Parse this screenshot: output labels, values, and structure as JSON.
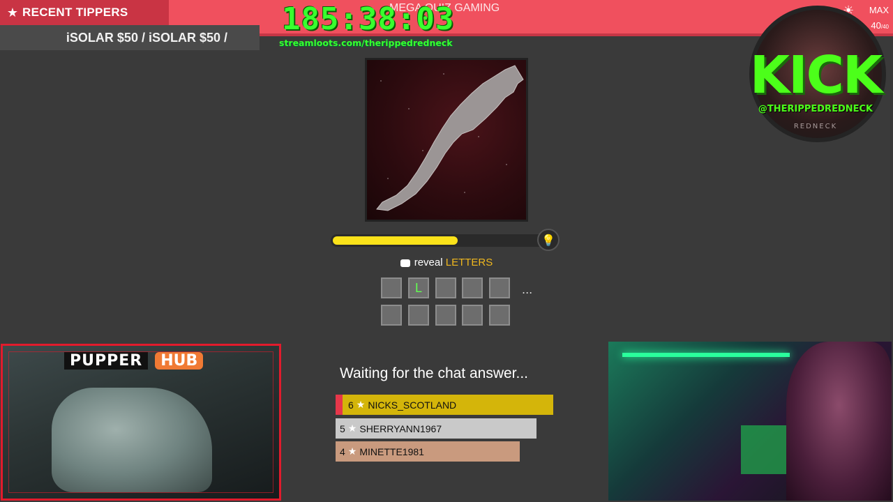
{
  "top_bar": {
    "game_title": "MEGA QUIZ GAMING",
    "timer": "185:38:03",
    "loot_url": "streamloots.com/therippedredneck"
  },
  "recent_tippers": {
    "label": "RECENT TIPPERS",
    "ticker": "iSOLAR $50 / iSOLAR $50 /"
  },
  "max_counter": {
    "label": "MAX",
    "count": "40",
    "total": "/40"
  },
  "kick_logo": {
    "word": "KICK",
    "handle": "@THERIPPEDREDNECK",
    "sub": "REDNECK"
  },
  "quiz": {
    "timer_progress_fraction": 0.59,
    "reveal_prefix": "reveal",
    "reveal_word": "LETTERS",
    "tiles_row1": [
      "",
      "L",
      "",
      "",
      ""
    ],
    "tiles_row2": [
      "",
      "",
      "",
      "",
      ""
    ],
    "overflow": "...",
    "waiting_text": "Waiting for the chat answer...",
    "leaderboard": [
      {
        "rank": "6",
        "name": "NICKS_SCOTLAND",
        "color": "#d4b50a"
      },
      {
        "rank": "5",
        "name": "SHERRYANN1967",
        "color": "#c9c9c9"
      },
      {
        "rank": "4",
        "name": "MINETTE1981",
        "color": "#c99a7e"
      }
    ]
  },
  "left_cam": {
    "brand_a": "PUPPER",
    "brand_b": "HUB"
  },
  "colors": {
    "accent_red": "#f0505e",
    "timer_green": "#39ff2e",
    "kick_green": "#4cff1a",
    "progress_yellow": "#fbe21a",
    "letters_orange": "#f0b81e"
  }
}
